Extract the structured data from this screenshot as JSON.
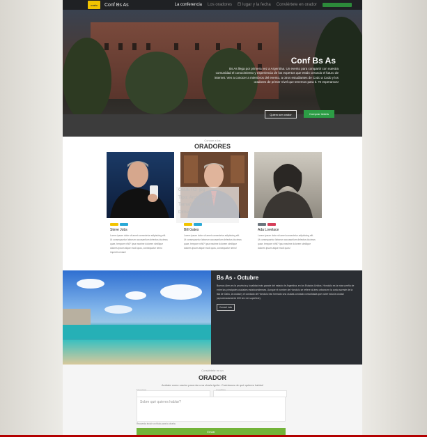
{
  "nav": {
    "logo_text": "codo",
    "brand": "Conf Bs As",
    "links": [
      "La conferencia",
      "Los oradores",
      "El lugar y la fecha",
      "Conviértete en orador"
    ]
  },
  "hero": {
    "title": "Conf Bs As",
    "text": "Bs As llega por primera vez a Argentina. Un evento para compartir con nuestra comunidad el conocimiento y experiencia de los expertos que están creando el futuro de internet. Ven a conocer a miembros del evento, a otros estudiantes de Codo a Codo y los oradores de primer nivel que tenemos para ti. Te esperamos!",
    "btn_outline": "Quiero ser orador",
    "btn_green": "Comprar tickets"
  },
  "speakers": {
    "kicker": "Conoce a los",
    "title": "ORADORES",
    "cards": [
      {
        "name": "Steve Jobs",
        "bio": "Lorem ipsum dolor sit amet consectetur adipisicing elit. Ut consequuntur laborum accusantium delectus ducimus quae, tempore nihil? Ipsa maxime dolorem similique dolores ipsum atque modi quos, consequatur nemo impedit veniam!"
      },
      {
        "name": "Bill Gates",
        "bio": "Lorem ipsum dolor sit amet consectetur adipisicing elit. Ut consequuntur laborum accusantium delectus ducimus quae, tempore nihil? Ipsa maxime dolorem similique dolores ipsum atque modi quos, consequatur nemo!"
      },
      {
        "name": "Ada Lovelace",
        "bio": "Lorem ipsum dolor sit amet consectetur adipisicing elit. Ut consequuntur laborum accusantium delectus ducimus quae, tempore nihil? Ipsa maxime dolorem similique dolores ipsum atque modi quos!"
      }
    ]
  },
  "tooltip": {
    "line1": "OBJETO: jpg",
    "line2": "Tipo: Archivo JPG",
    "line3": "Tamaño: 994 KB",
    "line4": "Dimensión: 1912 x 2048"
  },
  "venue": {
    "title": "Bs As - Octubre",
    "text": "Buenos Aires es la provincia y localidad más grande del estado de Argentina, en los Estados Unidos. Honolulu es la más sureña de entre las principales ciudades estadounidenses. Aunque el nombre de Honolulu se refiere al área urbana en la costa sureste de la isla de Oahu, la ciudad y el condado de Honolulu han formado una ciudad-condado consolidada que cubre toda la ciudad (aproximadamente 600 km² de superficie).",
    "button": "Conocé más"
  },
  "form": {
    "kicker": "Conviértete en un",
    "title": "ORADOR",
    "subtitle": "Anótate como orador para dar una charla ignite. Cuéntanos de qué quieres hablar!",
    "name_label": "Nombre",
    "surname_label": "Apellido",
    "textarea_placeholder": "Sobre qué quieres hablar?",
    "hint": "Recuerda incluir un título para tu charla.",
    "submit": "Enviar"
  },
  "colors": {
    "accent_green": "#2c9d45",
    "submit_green": "#72b338",
    "logo_yellow": "#f2c400"
  }
}
